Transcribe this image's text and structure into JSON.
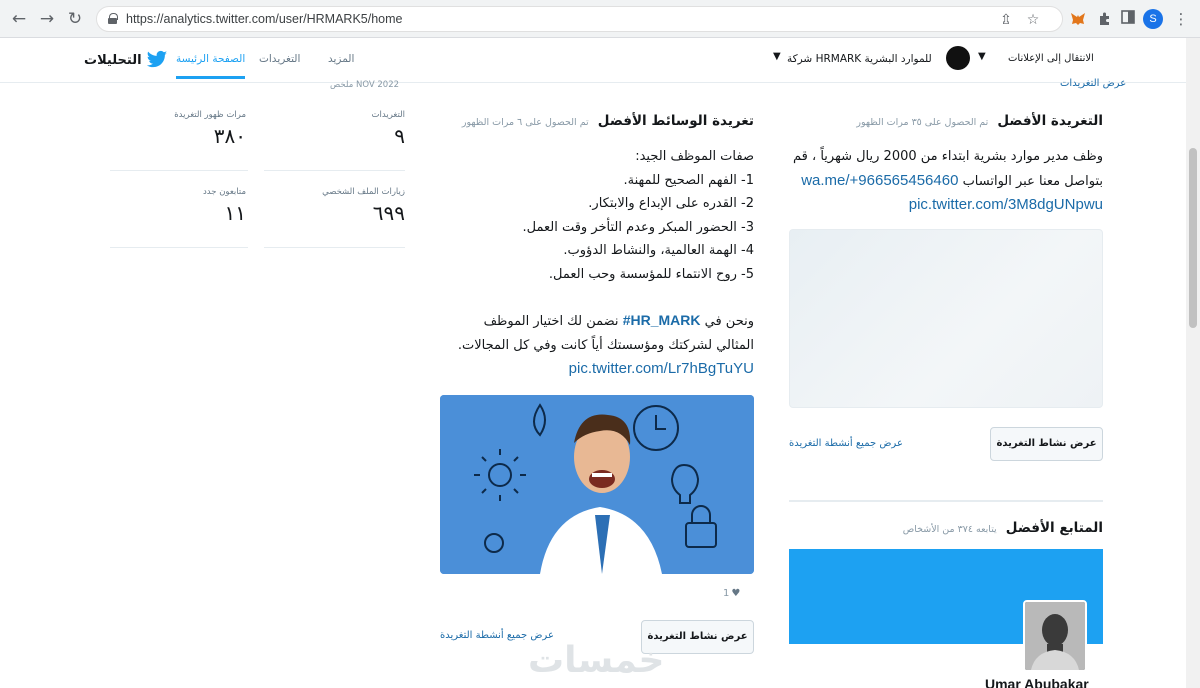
{
  "browser": {
    "url": "https://analytics.twitter.com/user/HRMARK5/home",
    "profile_initial": "S"
  },
  "header": {
    "logo_text": "التحليلات",
    "tabs": [
      {
        "label": "الصفحة الرئيسة",
        "active": true
      },
      {
        "label": "التغريدات",
        "active": false
      },
      {
        "label": "المزيد",
        "active": false
      }
    ],
    "account_name": "شركة HRMARK للموارد البشرية",
    "ads_link": "الانتقال إلى الإعلانات"
  },
  "summary": {
    "period": "ملخص NOV 2022",
    "stats": [
      {
        "label": "التغريدات",
        "value": "٩"
      },
      {
        "label": "مرات ظهور التغريدة",
        "value": "٣٨٠"
      },
      {
        "label": "زيارات الملف الشخصي",
        "value": "٦٩٩"
      },
      {
        "label": "متابعون جدد",
        "value": "١١"
      }
    ]
  },
  "top_tweet": {
    "title": "التغريدة الأفضل",
    "subtitle": "تم الحصول على ٣٥ مرات الظهور",
    "partial_link": "عرض التغريدات",
    "text_line1": "وظف مدير موارد بشرية ابتداء من 2000 ريال شهرياً ، قم",
    "text_line2": "بتواصل معنا عبر الواتساب",
    "link1": "wa.me/+966565456460",
    "link2": "pic.twitter.com/3M8dgUNpwu",
    "button": "عرض نشاط التغريدة",
    "all_activity": "عرض جميع أنشطة التغريدة"
  },
  "top_media_tweet": {
    "title": "تغريدة الوسائط الأفضل",
    "subtitle": "تم الحصول على ٦ مرات الظهور",
    "lines": [
      "صفات الموظف الجيد:",
      "1- الفهم الصحيح للمهنة.",
      "2- القدره على الإبداع والابتكار.",
      "3- الحضور المبكر وعدم التأخر وقت العمل.",
      "4- الهمة العالمية، والنشاط الدؤوب.",
      "5-  روح الانتماء للمؤسسة وحب العمل."
    ],
    "para_before_tag": "ونحن في",
    "hashtag": "#HR_MARK",
    "para_after_tag": "نضمن لك اختيار الموظف",
    "para_line2": "المثالي لشركتك ومؤسستك أياً كانت وفي كل المجالات.",
    "link": "pic.twitter.com/Lr7hBgTuYU",
    "likes": "1",
    "button": "عرض نشاط التغريدة",
    "all_activity": "عرض جميع أنشطة التغريدة"
  },
  "top_follower": {
    "title": "المتابع الأفضل",
    "subtitle": "يتابعه ٣٧٤ من الأشخاص",
    "name": "Umar Abubakar"
  },
  "watermark": "خمسات",
  "colors": {
    "twitter_blue": "#1da1f2",
    "link": "#1b6ba8",
    "media_bg": "#4a90d9"
  }
}
